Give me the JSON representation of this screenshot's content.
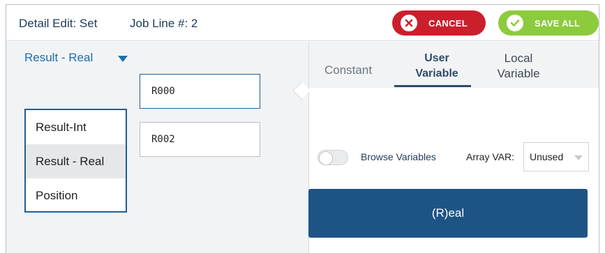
{
  "header": {
    "title": "Detail Edit: Set",
    "job_line": "Job Line #: 2",
    "cancel_label": "CANCEL",
    "save_label": "SAVE ALL"
  },
  "colors": {
    "cancel": "#cc1f2c",
    "save": "#8ccb3c",
    "primary": "#1e5485",
    "accent_text": "#1b6fae"
  },
  "left_panel": {
    "type_dropdown": {
      "selected": "Result - Real",
      "options": [
        "Result-Int",
        "Result - Real",
        "Position"
      ]
    },
    "inputs": [
      "R000",
      "R002"
    ]
  },
  "tabs": [
    {
      "label": "Constant",
      "active": false
    },
    {
      "label": "User\nVariable",
      "active": true
    },
    {
      "label": "Local\nVariable",
      "active": false
    }
  ],
  "tab_labels": {
    "constant": "Constant",
    "user_line1": "User",
    "user_line2": "Variable",
    "local_line1": "Local",
    "local_line2": "Variable"
  },
  "right_panel": {
    "browse_label": "Browse Variables",
    "browse_on": false,
    "array_label": "Array VAR:",
    "array_value": "Unused",
    "type_button": "(R)eal"
  },
  "icons": {
    "cancel": "x-circle-icon",
    "save": "check-circle-icon",
    "dropdown": "caret-down-icon"
  }
}
